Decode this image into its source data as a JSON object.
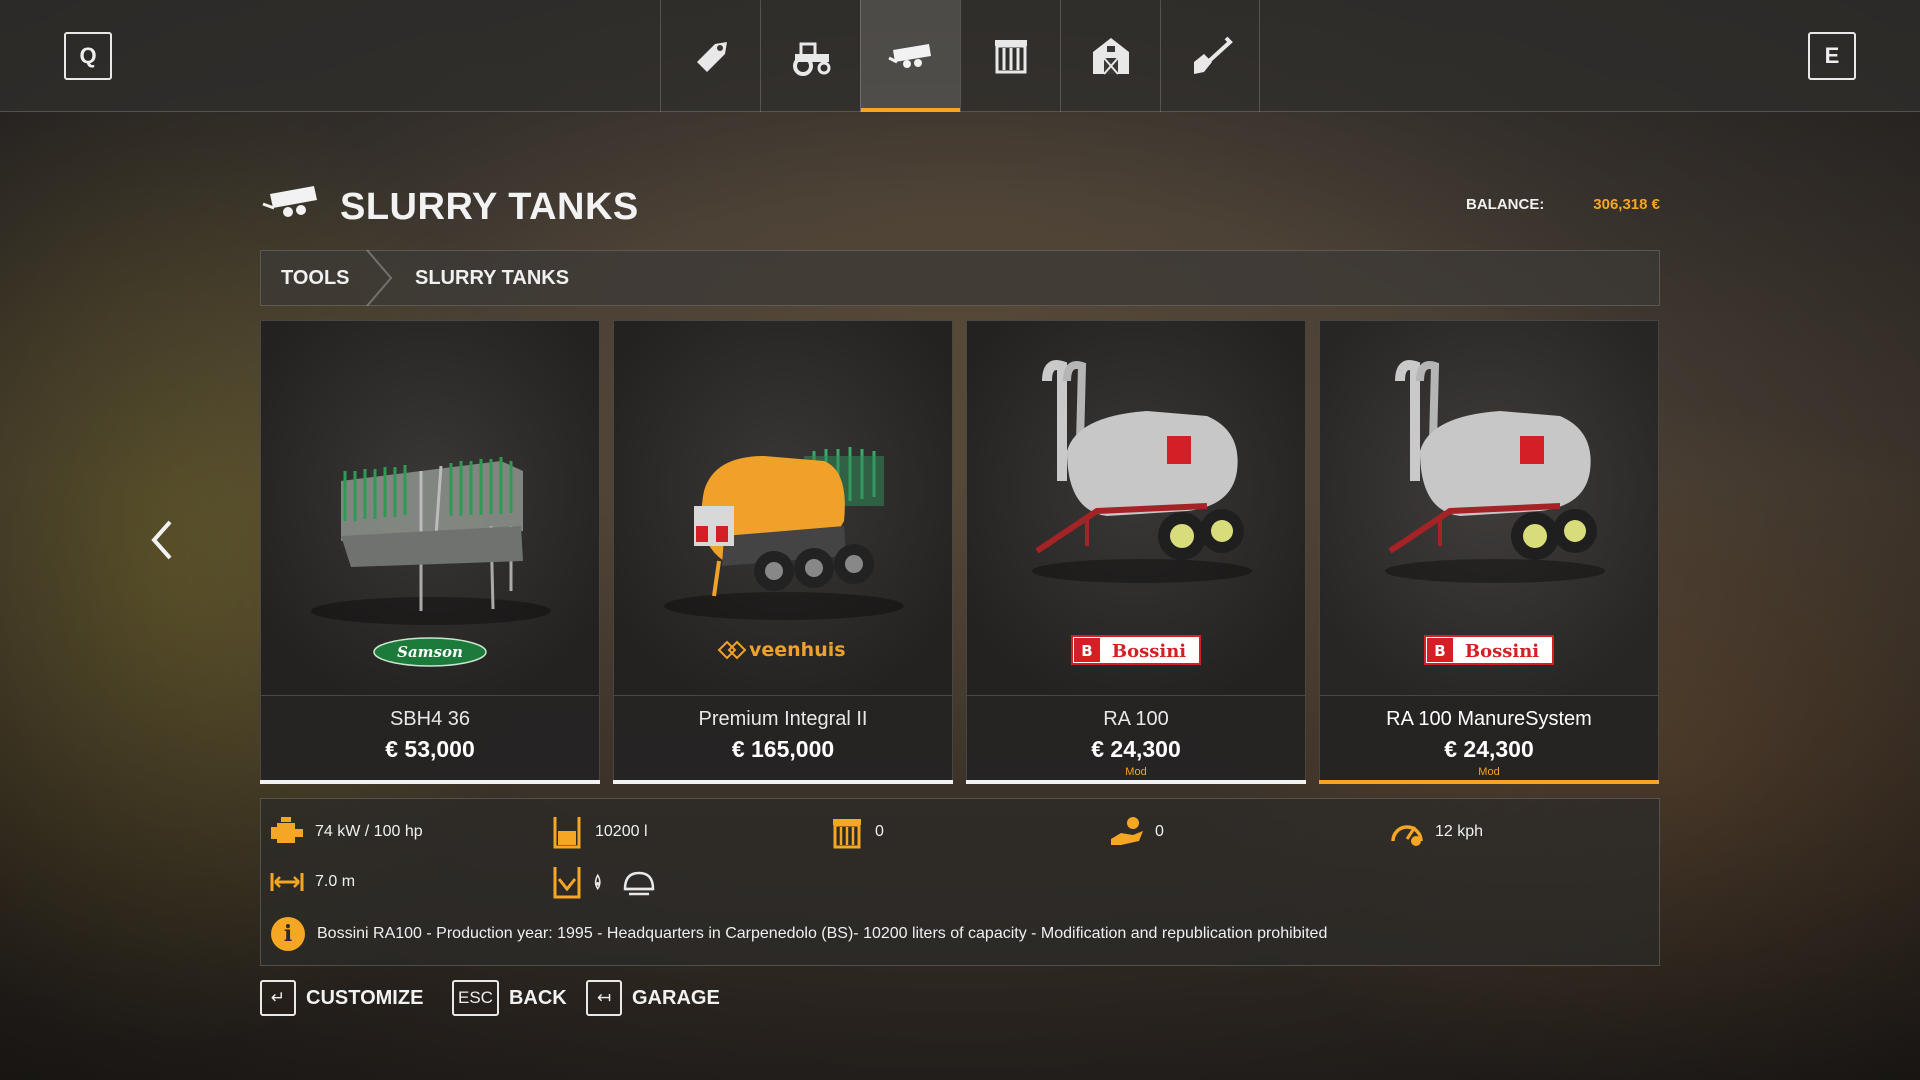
{
  "topbar": {
    "left_key": "Q",
    "right_key": "E",
    "tabs": [
      {
        "icon": "price-tag-icon",
        "active": false
      },
      {
        "icon": "tractor-icon",
        "active": false
      },
      {
        "icon": "slurry-tank-icon",
        "active": true
      },
      {
        "icon": "warehouse-icon",
        "active": false
      },
      {
        "icon": "barn-icon",
        "active": false
      },
      {
        "icon": "shovel-icon",
        "active": false
      }
    ]
  },
  "header": {
    "title": "SLURRY TANKS",
    "balance_label": "BALANCE:",
    "balance_value": "306,318 €"
  },
  "breadcrumb": {
    "items": [
      "TOOLS",
      "SLURRY TANKS"
    ]
  },
  "cards": [
    {
      "name": "SBH4 36",
      "price": "€ 53,000",
      "mod": "",
      "brand": "Samson",
      "selected": false
    },
    {
      "name": "Premium Integral II",
      "price": "€ 165,000",
      "mod": "",
      "brand": "veenhuis",
      "selected": false
    },
    {
      "name": "RA 100",
      "price": "€ 24,300",
      "mod": "Mod",
      "brand": "Bossini",
      "selected": false
    },
    {
      "name": "RA 100 ManureSystem",
      "price": "€ 24,300",
      "mod": "Mod",
      "brand": "Bossini",
      "selected": true
    }
  ],
  "details": {
    "power": "74 kW / 100 hp",
    "capacity": "10200 l",
    "upkeep": "0",
    "daily": "0",
    "speed": "12 kph",
    "width": "7.0 m",
    "description": "Bossini RA100 - Production year: 1995 - Headquarters in Carpenedolo (BS)- 10200 liters of capacity - Modification and republication prohibited"
  },
  "buttons": {
    "customize_key": "↵",
    "customize": "CUSTOMIZE",
    "back_key": "ESC",
    "back": "BACK",
    "garage_key": "↤",
    "garage": "GARAGE"
  },
  "colors": {
    "accent": "#f5a623",
    "samson_green": "#1c7a3a",
    "veenhuis_orange": "#f0a12a",
    "bossini_red": "#d41f26"
  }
}
